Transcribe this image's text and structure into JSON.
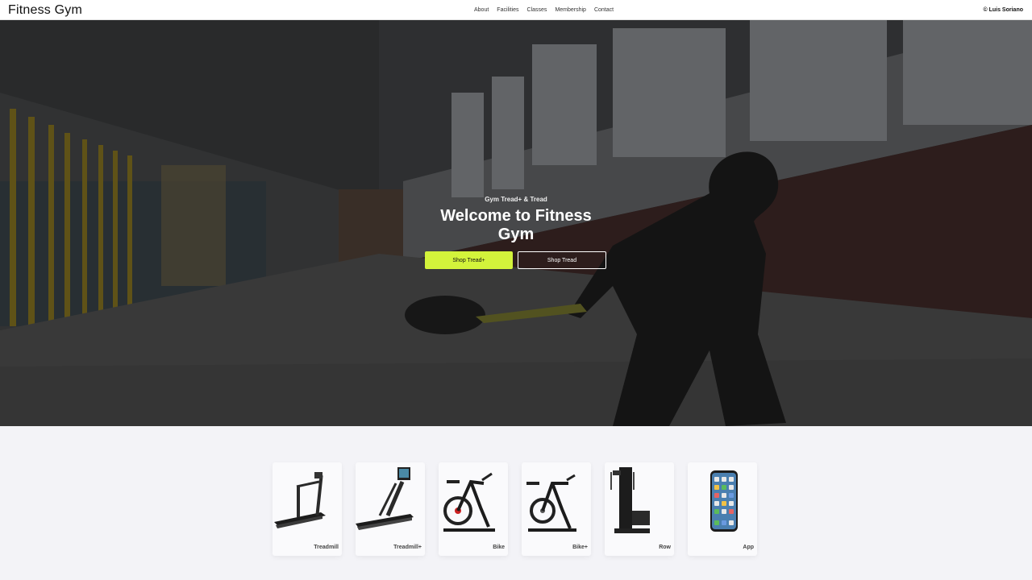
{
  "header": {
    "brand": "Fitness Gym",
    "nav": [
      "About",
      "Facilities",
      "Classes",
      "Membership",
      "Contact"
    ],
    "copyright": "© Luis Soriano"
  },
  "hero": {
    "eyebrow": "Gym Tread+ & Tread",
    "title": "Welcome to Fitness Gym",
    "primary_button": "Shop Tread+",
    "secondary_button": "Shop Tread",
    "accent_color": "#d3f33b"
  },
  "products": [
    {
      "label": "Treadmill",
      "icon": "treadmill-icon"
    },
    {
      "label": "Treadmill+",
      "icon": "treadmill-plus-icon"
    },
    {
      "label": "Bike",
      "icon": "bike-icon"
    },
    {
      "label": "Bike+",
      "icon": "bike-plus-icon"
    },
    {
      "label": "Row",
      "icon": "row-machine-icon"
    },
    {
      "label": "App",
      "icon": "phone-app-icon"
    }
  ]
}
